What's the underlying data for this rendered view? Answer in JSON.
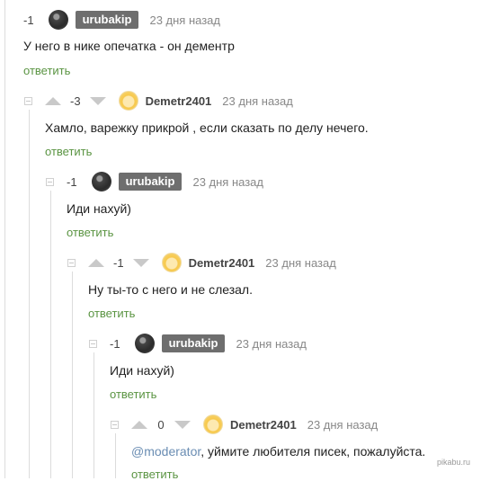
{
  "comments": [
    {
      "rating": "-1",
      "author": "urubakip",
      "time": "23 дня назад",
      "text": "У него в нике опечатка - он дементр",
      "reply": "ответить"
    },
    {
      "rating": "-3",
      "author": "Demetr2401",
      "time": "23 дня назад",
      "text": "Хамло, варежку прикрой , если сказать по делу нечего.",
      "reply": "ответить"
    },
    {
      "rating": "-1",
      "author": "urubakip",
      "time": "23 дня назад",
      "text": "Иди нахуй)",
      "reply": "ответить"
    },
    {
      "rating": "-1",
      "author": "Demetr2401",
      "time": "23 дня назад",
      "text": "Ну ты-то с него и не слезал.",
      "reply": "ответить"
    },
    {
      "rating": "-1",
      "author": "urubakip",
      "time": "23 дня назад",
      "text": "Иди нахуй)",
      "reply": "ответить"
    },
    {
      "rating": "0",
      "author": "Demetr2401",
      "time": "23 дня назад",
      "mention": "@moderator",
      "text": ", уймите любителя писек, пожалуйста.",
      "reply": "ответить"
    }
  ],
  "watermark": "pikabu.ru",
  "colors": {
    "reply_link": "#5a9442",
    "author_badge_bg": "#6e6e6e",
    "mention": "#6a8db3",
    "thread_line": "#dcdcdc"
  }
}
